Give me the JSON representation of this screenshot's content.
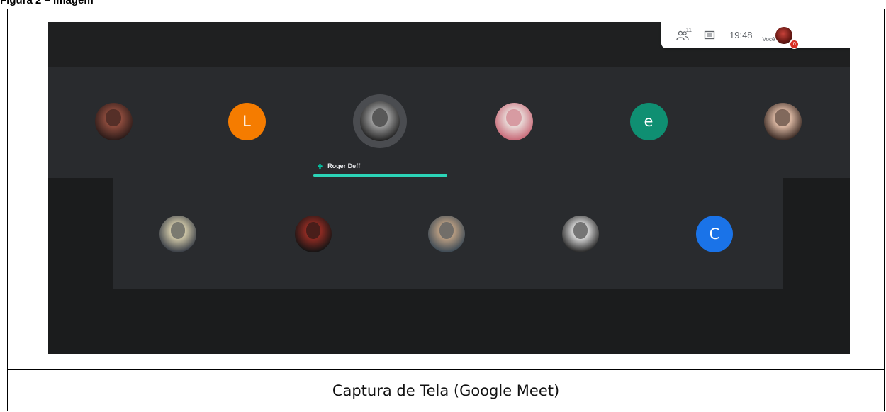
{
  "document": {
    "heading": "Figura 2 – Imagem",
    "caption": "Captura de Tela (Google Meet)"
  },
  "meet": {
    "controls": {
      "people_icon": "people-icon",
      "participant_count": "11",
      "chat_icon": "chat-icon",
      "clock": "19:48",
      "you_label": "Você",
      "notification_count": "0"
    },
    "active_speaker": {
      "name": "Roger Deff",
      "indicator_icon": "audio-wave-icon",
      "bar_color": "#2bd4b7"
    },
    "participants_row1": [
      {
        "kind": "photo",
        "icon": "participant-photo",
        "colors": [
          "#8a4a3c",
          "#2a1a18"
        ]
      },
      {
        "kind": "letter",
        "letter": "L",
        "color": "#f57c00"
      },
      {
        "kind": "photo",
        "icon": "participant-photo",
        "colors": [
          "#9a9a9a",
          "#222222"
        ],
        "speaking": true
      },
      {
        "kind": "photo",
        "icon": "participant-photo",
        "colors": [
          "#e8d7d5",
          "#c86a78"
        ]
      },
      {
        "kind": "letter",
        "letter": "e",
        "color": "#0f8f72"
      },
      {
        "kind": "photo",
        "icon": "participant-photo",
        "colors": [
          "#d8b5a0",
          "#3a2a24"
        ]
      }
    ],
    "participants_row2": [
      {
        "kind": "photo",
        "icon": "participant-photo",
        "colors": [
          "#c9c1a3",
          "#3a3f47"
        ]
      },
      {
        "kind": "photo",
        "icon": "participant-photo",
        "colors": [
          "#8a2a22",
          "#141414"
        ]
      },
      {
        "kind": "photo",
        "icon": "participant-photo",
        "colors": [
          "#b49a80",
          "#3d4a55"
        ]
      },
      {
        "kind": "photo",
        "icon": "participant-photo",
        "colors": [
          "#d0d0d0",
          "#2a2a2a"
        ]
      },
      {
        "kind": "letter",
        "letter": "C",
        "color": "#1a73e8"
      }
    ]
  }
}
